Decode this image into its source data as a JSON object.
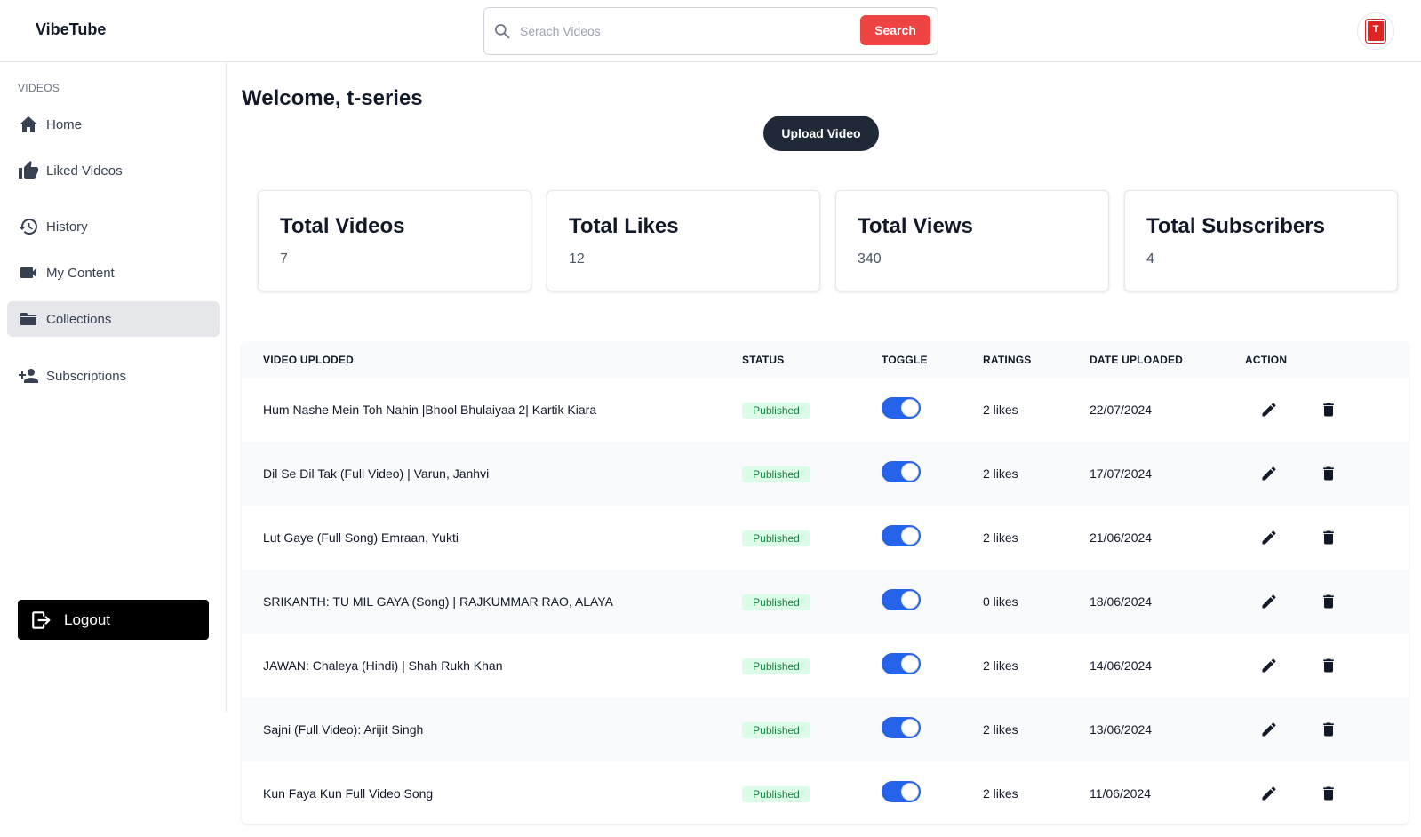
{
  "header": {
    "brand": "VibeTube",
    "search_placeholder": "Serach Videos",
    "search_value": "",
    "search_button": "Search",
    "avatar_letter": "T"
  },
  "sidebar": {
    "section_label": "VIDEOS",
    "items": [
      {
        "label": "Home",
        "icon": "home-icon"
      },
      {
        "label": "Liked Videos",
        "icon": "thumbs-up-icon"
      },
      {
        "label": "History",
        "icon": "history-icon"
      },
      {
        "label": "My Content",
        "icon": "video-camera-icon"
      },
      {
        "label": "Collections",
        "icon": "folder-icon",
        "active": true
      },
      {
        "label": "Subscriptions",
        "icon": "add-user-icon"
      }
    ],
    "logout_label": "Logout"
  },
  "main": {
    "welcome": "Welcome, t-series",
    "upload_button": "Upload Video",
    "stats": [
      {
        "label": "Total Videos",
        "value": "7"
      },
      {
        "label": "Total Likes",
        "value": "12"
      },
      {
        "label": "Total Views",
        "value": "340"
      },
      {
        "label": "Total Subscribers",
        "value": "4"
      }
    ]
  },
  "table": {
    "headers": {
      "video": "VIDEO UPLODED",
      "status": "STATUS",
      "toggle": "TOGGLE",
      "ratings": "RATINGS",
      "date": "DATE UPLOADED",
      "action": "ACTION"
    },
    "rows": [
      {
        "title": "Hum Nashe Mein Toh Nahin |Bhool Bhulaiyaa 2| Kartik Kiara",
        "status": "Published",
        "published": true,
        "ratings": "2 likes",
        "date": "22/07/2024"
      },
      {
        "title": "Dil Se Dil Tak (Full Video) | Varun, Janhvi",
        "status": "Published",
        "published": true,
        "ratings": "2 likes",
        "date": "17/07/2024"
      },
      {
        "title": "Lut Gaye (Full Song) Emraan, Yukti",
        "status": "Published",
        "published": true,
        "ratings": "2 likes",
        "date": "21/06/2024"
      },
      {
        "title": "SRIKANTH: TU MIL GAYA (Song) | RAJKUMMAR RAO, ALAYA",
        "status": "Published",
        "published": true,
        "ratings": "0 likes",
        "date": "18/06/2024"
      },
      {
        "title": "JAWAN: Chaleya (Hindi) | Shah Rukh Khan",
        "status": "Published",
        "published": true,
        "ratings": "2 likes",
        "date": "14/06/2024"
      },
      {
        "title": "Sajni (Full Video): Arijit Singh",
        "status": "Published",
        "published": true,
        "ratings": "2 likes",
        "date": "13/06/2024"
      },
      {
        "title": "Kun Faya Kun Full Video Song",
        "status": "Published",
        "published": true,
        "ratings": "2 likes",
        "date": "11/06/2024"
      }
    ]
  },
  "colors": {
    "accent_red": "#ef4444",
    "toggle_blue": "#2563eb",
    "badge_green_bg": "#dcfce7",
    "badge_green_text": "#15803d",
    "dark_button": "#1f2937"
  }
}
